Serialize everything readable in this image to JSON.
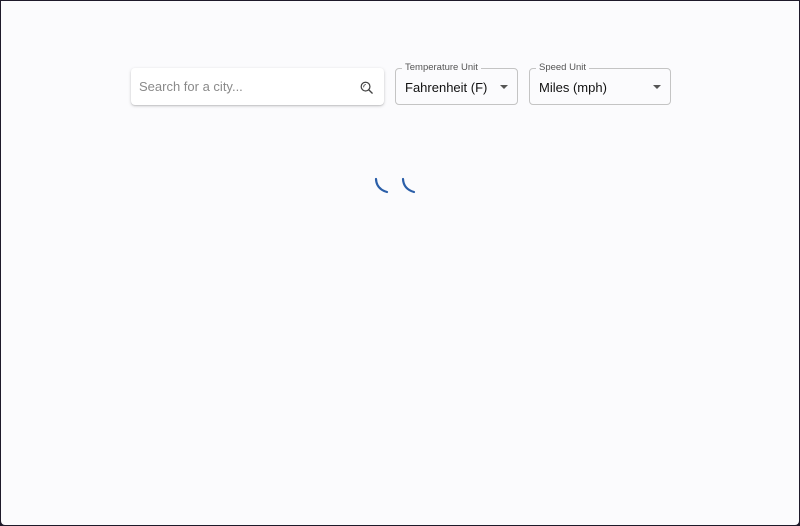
{
  "search": {
    "placeholder": "Search for a city...",
    "value": "",
    "icon": "search-icon"
  },
  "temperature_unit": {
    "label": "Temperature Unit",
    "selected": "Fahrenheit (F)",
    "icon": "chevron-down-icon"
  },
  "speed_unit": {
    "label": "Speed Unit",
    "selected": "Miles (mph)",
    "icon": "chevron-down-icon"
  },
  "loading": {
    "icon": "loading-spinner-icon",
    "color": "#2a5ea8"
  }
}
